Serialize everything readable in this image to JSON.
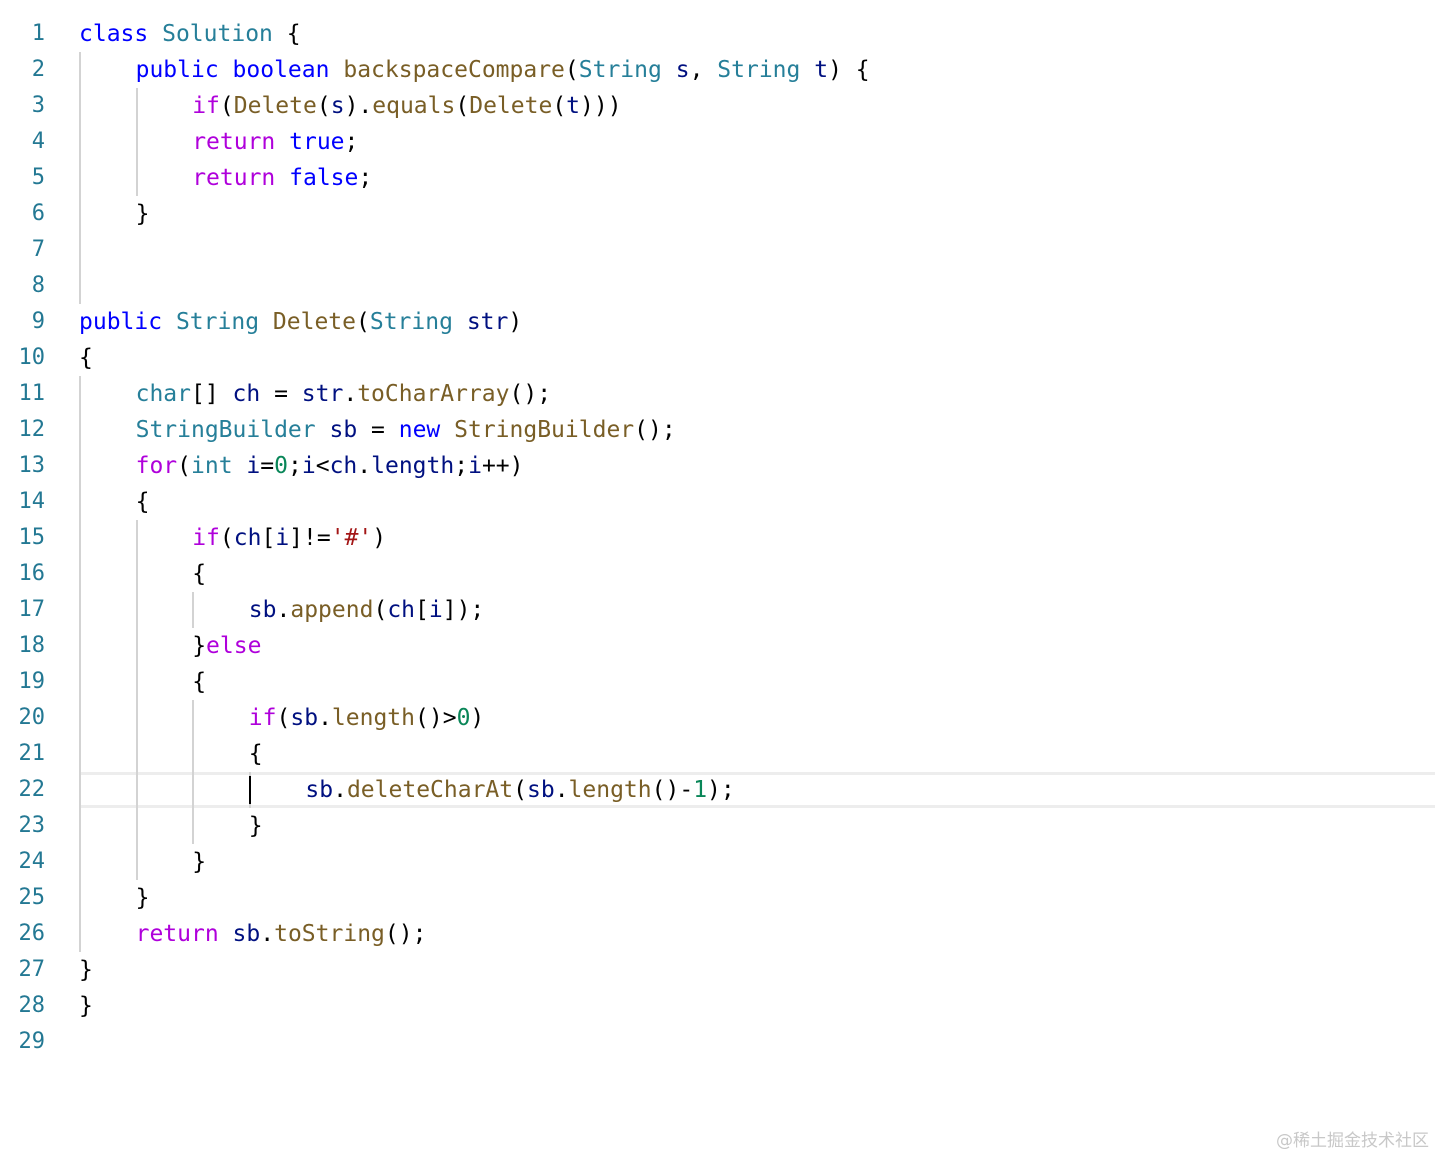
{
  "editor": {
    "theme": {
      "keyword": "#0000ff",
      "control": "#af00db",
      "type": "#267f99",
      "function": "#795e26",
      "variable": "#001080",
      "number": "#098658",
      "string": "#a31515",
      "plain": "#000000",
      "line_number": "#237893",
      "indent_guide": "#d3d3d3",
      "current_line_border": "#ededed"
    },
    "current_line": 22,
    "lines": [
      {
        "n": "1",
        "indent": 0,
        "t": [
          [
            "keyword",
            "class"
          ],
          [
            "plain",
            " "
          ],
          [
            "type",
            "Solution"
          ],
          [
            "plain",
            " {"
          ]
        ]
      },
      {
        "n": "2",
        "indent": 1,
        "t": [
          [
            "keyword",
            "public"
          ],
          [
            "plain",
            " "
          ],
          [
            "keyword",
            "boolean"
          ],
          [
            "plain",
            " "
          ],
          [
            "function",
            "backspaceCompare"
          ],
          [
            "plain",
            "("
          ],
          [
            "type",
            "String"
          ],
          [
            "plain",
            " "
          ],
          [
            "variable",
            "s"
          ],
          [
            "plain",
            ", "
          ],
          [
            "type",
            "String"
          ],
          [
            "plain",
            " "
          ],
          [
            "variable",
            "t"
          ],
          [
            "plain",
            ") {"
          ]
        ]
      },
      {
        "n": "3",
        "indent": 2,
        "t": [
          [
            "control",
            "if"
          ],
          [
            "plain",
            "("
          ],
          [
            "function",
            "Delete"
          ],
          [
            "plain",
            "("
          ],
          [
            "variable",
            "s"
          ],
          [
            "plain",
            ")."
          ],
          [
            "function",
            "equals"
          ],
          [
            "plain",
            "("
          ],
          [
            "function",
            "Delete"
          ],
          [
            "plain",
            "("
          ],
          [
            "variable",
            "t"
          ],
          [
            "plain",
            ")))"
          ]
        ]
      },
      {
        "n": "4",
        "indent": 2,
        "t": [
          [
            "control",
            "return"
          ],
          [
            "plain",
            " "
          ],
          [
            "keyword",
            "true"
          ],
          [
            "plain",
            ";"
          ]
        ]
      },
      {
        "n": "5",
        "indent": 2,
        "t": [
          [
            "control",
            "return"
          ],
          [
            "plain",
            " "
          ],
          [
            "keyword",
            "false"
          ],
          [
            "plain",
            ";"
          ]
        ]
      },
      {
        "n": "6",
        "indent": 1,
        "t": [
          [
            "plain",
            "}"
          ]
        ]
      },
      {
        "n": "7",
        "indent": 0,
        "t": []
      },
      {
        "n": "8",
        "indent": 0,
        "t": []
      },
      {
        "n": "9",
        "indent": 0,
        "t": [
          [
            "keyword",
            "public"
          ],
          [
            "plain",
            " "
          ],
          [
            "type",
            "String"
          ],
          [
            "plain",
            " "
          ],
          [
            "function",
            "Delete"
          ],
          [
            "plain",
            "("
          ],
          [
            "type",
            "String"
          ],
          [
            "plain",
            " "
          ],
          [
            "variable",
            "str"
          ],
          [
            "plain",
            ")"
          ]
        ]
      },
      {
        "n": "10",
        "indent": 0,
        "t": [
          [
            "plain",
            "{"
          ]
        ]
      },
      {
        "n": "11",
        "indent": 1,
        "t": [
          [
            "type",
            "char"
          ],
          [
            "plain",
            "[] "
          ],
          [
            "variable",
            "ch"
          ],
          [
            "plain",
            " = "
          ],
          [
            "variable",
            "str"
          ],
          [
            "plain",
            "."
          ],
          [
            "function",
            "toCharArray"
          ],
          [
            "plain",
            "();"
          ]
        ]
      },
      {
        "n": "12",
        "indent": 1,
        "t": [
          [
            "type",
            "StringBuilder"
          ],
          [
            "plain",
            " "
          ],
          [
            "variable",
            "sb"
          ],
          [
            "plain",
            " = "
          ],
          [
            "keyword",
            "new"
          ],
          [
            "plain",
            " "
          ],
          [
            "function",
            "StringBuilder"
          ],
          [
            "plain",
            "();"
          ]
        ]
      },
      {
        "n": "13",
        "indent": 1,
        "t": [
          [
            "control",
            "for"
          ],
          [
            "plain",
            "("
          ],
          [
            "type",
            "int"
          ],
          [
            "plain",
            " "
          ],
          [
            "variable",
            "i"
          ],
          [
            "plain",
            "="
          ],
          [
            "number",
            "0"
          ],
          [
            "plain",
            ";"
          ],
          [
            "variable",
            "i"
          ],
          [
            "plain",
            "<"
          ],
          [
            "variable",
            "ch"
          ],
          [
            "plain",
            "."
          ],
          [
            "variable",
            "length"
          ],
          [
            "plain",
            ";"
          ],
          [
            "variable",
            "i"
          ],
          [
            "plain",
            "++)"
          ]
        ]
      },
      {
        "n": "14",
        "indent": 1,
        "t": [
          [
            "plain",
            "{"
          ]
        ]
      },
      {
        "n": "15",
        "indent": 2,
        "t": [
          [
            "control",
            "if"
          ],
          [
            "plain",
            "("
          ],
          [
            "variable",
            "ch"
          ],
          [
            "plain",
            "["
          ],
          [
            "variable",
            "i"
          ],
          [
            "plain",
            "]!="
          ],
          [
            "string",
            "'#'"
          ],
          [
            "plain",
            ")"
          ]
        ]
      },
      {
        "n": "16",
        "indent": 2,
        "t": [
          [
            "plain",
            "{"
          ]
        ]
      },
      {
        "n": "17",
        "indent": 3,
        "t": [
          [
            "variable",
            "sb"
          ],
          [
            "plain",
            "."
          ],
          [
            "function",
            "append"
          ],
          [
            "plain",
            "("
          ],
          [
            "variable",
            "ch"
          ],
          [
            "plain",
            "["
          ],
          [
            "variable",
            "i"
          ],
          [
            "plain",
            "]);"
          ]
        ]
      },
      {
        "n": "18",
        "indent": 2,
        "t": [
          [
            "plain",
            "}"
          ],
          [
            "control",
            "else"
          ]
        ]
      },
      {
        "n": "19",
        "indent": 2,
        "t": [
          [
            "plain",
            "{"
          ]
        ]
      },
      {
        "n": "20",
        "indent": 3,
        "t": [
          [
            "control",
            "if"
          ],
          [
            "plain",
            "("
          ],
          [
            "variable",
            "sb"
          ],
          [
            "plain",
            "."
          ],
          [
            "function",
            "length"
          ],
          [
            "plain",
            "()>"
          ],
          [
            "number",
            "0"
          ],
          [
            "plain",
            ")"
          ]
        ]
      },
      {
        "n": "21",
        "indent": 3,
        "t": [
          [
            "plain",
            "{"
          ]
        ]
      },
      {
        "n": "22",
        "indent": 4,
        "t": [
          [
            "variable",
            "sb"
          ],
          [
            "plain",
            "."
          ],
          [
            "function",
            "deleteCharAt"
          ],
          [
            "plain",
            "("
          ],
          [
            "variable",
            "sb"
          ],
          [
            "plain",
            "."
          ],
          [
            "function",
            "length"
          ],
          [
            "plain",
            "()-"
          ],
          [
            "number",
            "1"
          ],
          [
            "plain",
            ");"
          ]
        ]
      },
      {
        "n": "23",
        "indent": 3,
        "t": [
          [
            "plain",
            "}"
          ]
        ]
      },
      {
        "n": "24",
        "indent": 2,
        "t": [
          [
            "plain",
            "}"
          ]
        ]
      },
      {
        "n": "25",
        "indent": 1,
        "t": [
          [
            "plain",
            "}"
          ]
        ]
      },
      {
        "n": "26",
        "indent": 1,
        "t": [
          [
            "control",
            "return"
          ],
          [
            "plain",
            " "
          ],
          [
            "variable",
            "sb"
          ],
          [
            "plain",
            "."
          ],
          [
            "function",
            "toString"
          ],
          [
            "plain",
            "();"
          ]
        ]
      },
      {
        "n": "27",
        "indent": 0,
        "t": [
          [
            "plain",
            "}"
          ]
        ]
      },
      {
        "n": "28",
        "indent": 0,
        "t": [
          [
            "plain",
            "}"
          ]
        ]
      },
      {
        "n": "29",
        "indent": 0,
        "t": []
      }
    ],
    "guides": [
      {
        "level": 0,
        "from": 2,
        "to": 8
      },
      {
        "level": 0,
        "from": 11,
        "to": 26
      },
      {
        "level": 1,
        "from": 3,
        "to": 5
      },
      {
        "level": 1,
        "from": 15,
        "to": 24
      },
      {
        "level": 2,
        "from": 17,
        "to": 17
      },
      {
        "level": 2,
        "from": 20,
        "to": 23
      },
      {
        "level": 3,
        "from": 22,
        "to": 22
      }
    ]
  },
  "watermark": "@稀土掘金技术社区"
}
